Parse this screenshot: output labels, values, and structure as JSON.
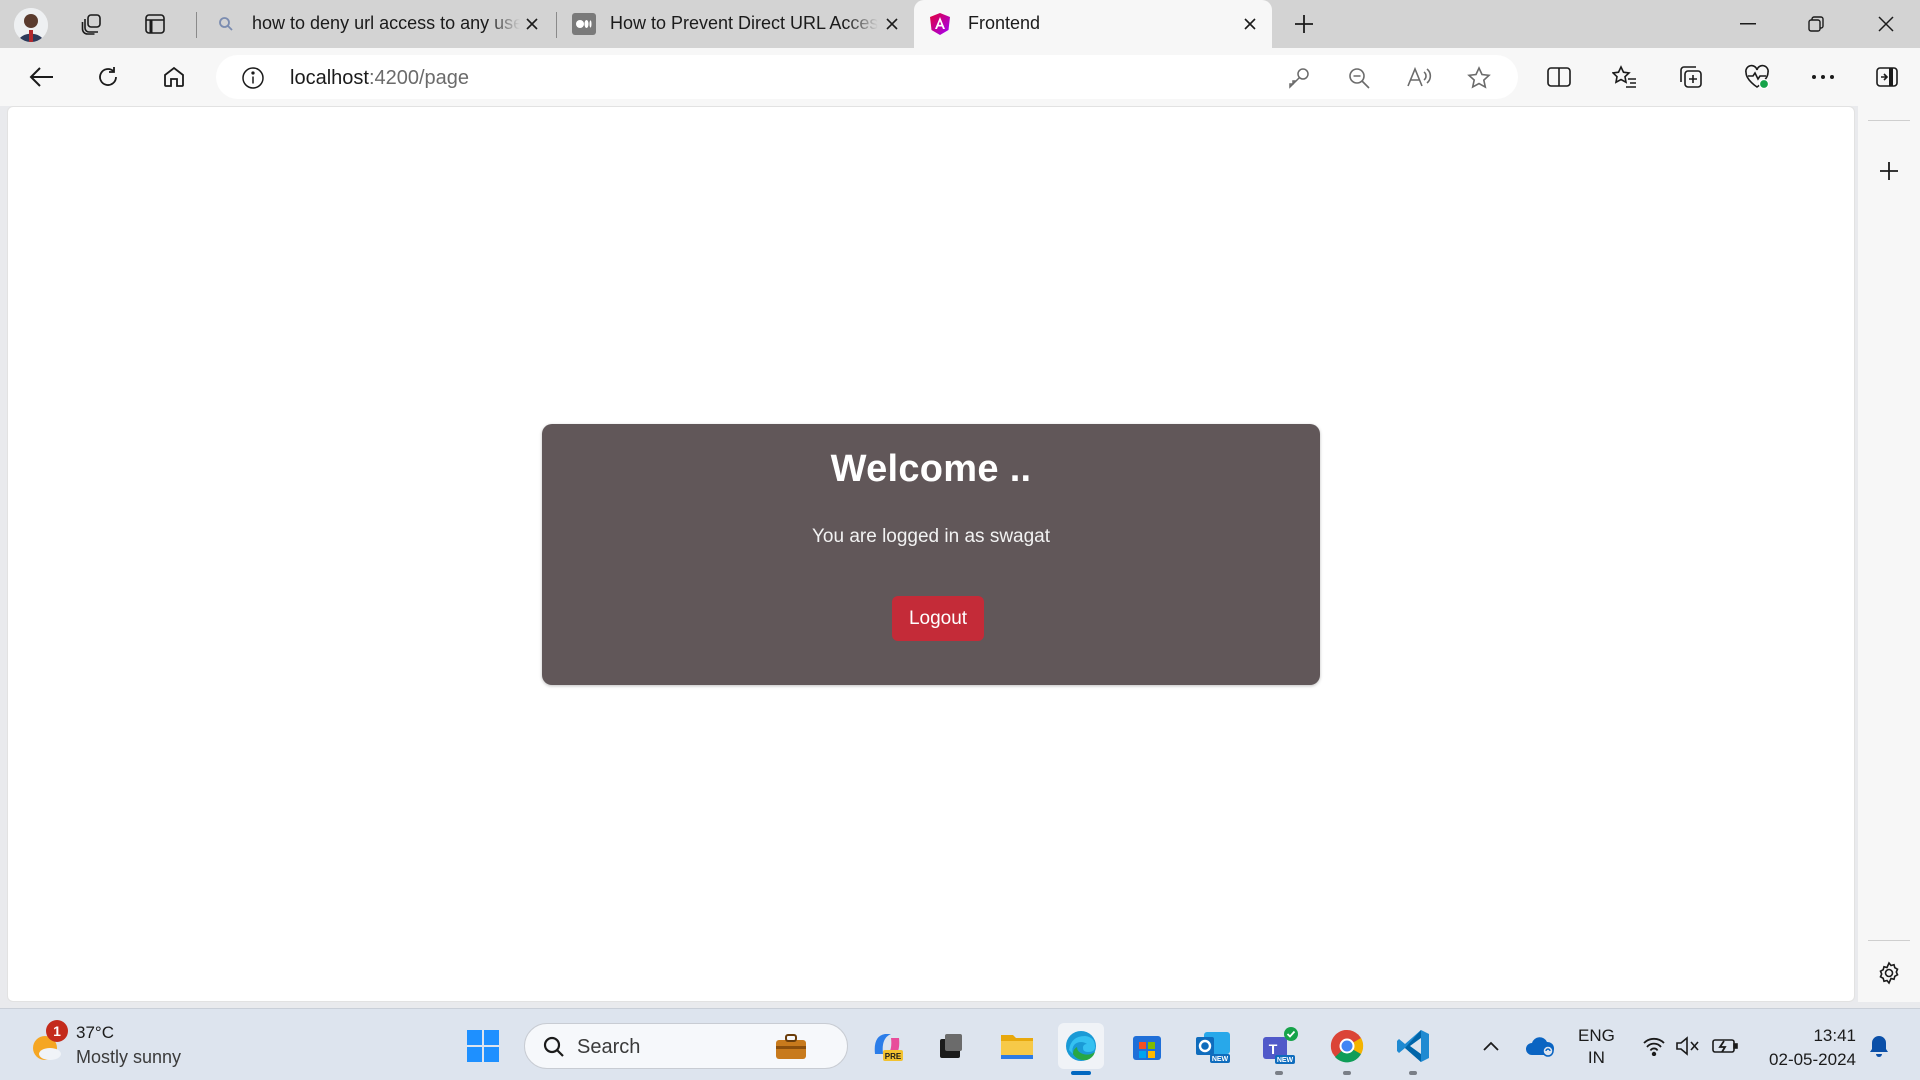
{
  "browser": {
    "tabs": [
      {
        "title": "how to deny url access to any user",
        "icon": "search-icon",
        "active": false
      },
      {
        "title": "How to Prevent Direct URL Access",
        "icon": "medium-logo-icon",
        "active": false
      },
      {
        "title": "Frontend",
        "icon": "angular-logo-icon",
        "active": true
      }
    ],
    "url_host": "localhost",
    "url_rest": ":4200/page"
  },
  "page": {
    "heading": "Welcome ..",
    "message": "You are logged in as swagat",
    "logout_label": "Logout"
  },
  "taskbar": {
    "weather": {
      "temp": "37°C",
      "condition": "Mostly sunny",
      "badge": "1"
    },
    "search_label": "Search",
    "lang_1": "ENG",
    "lang_2": "IN",
    "time": "13:41",
    "date": "02-05-2024"
  },
  "colors": {
    "card_bg": "#615759",
    "logout_bg": "#c42b38",
    "tabbar_bg": "#d3d3d3",
    "taskbar_bg": "#dde4ee"
  }
}
